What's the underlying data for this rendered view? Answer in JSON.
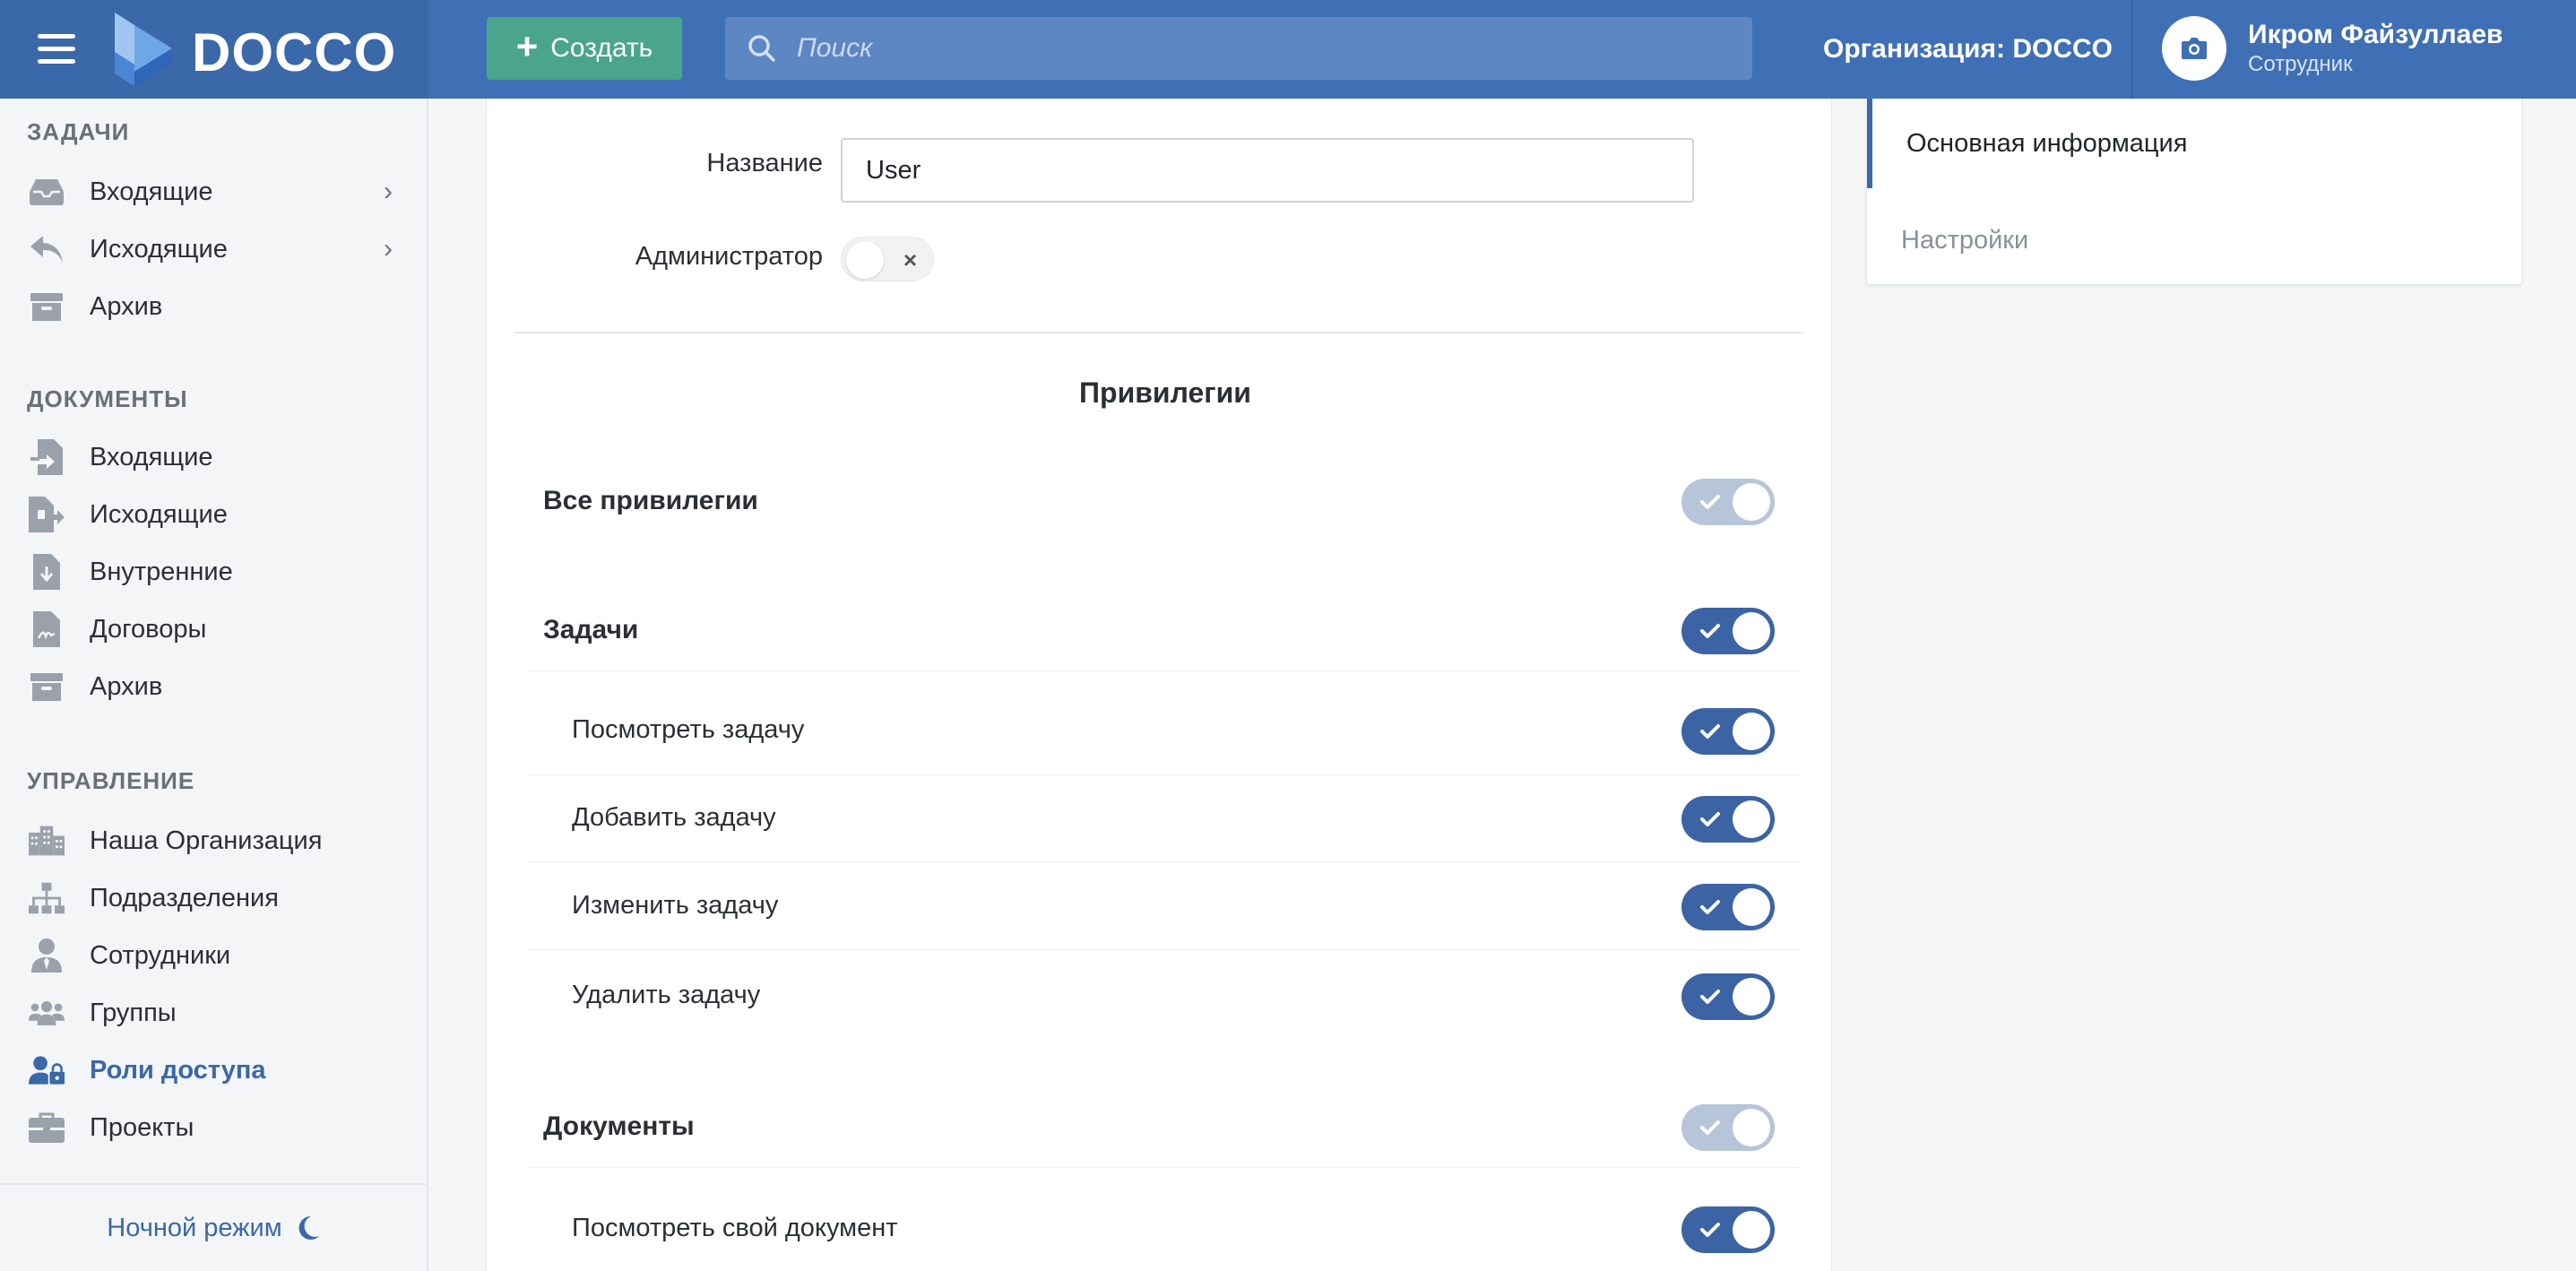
{
  "header": {
    "brand": "DOCCO",
    "create_label": "Создать",
    "search_placeholder": "Поиск",
    "organization": "Организация: DOCCO",
    "user_name": "Икром Файзуллаев",
    "user_role": "Сотрудник"
  },
  "sidebar": {
    "tasks_title": "ЗАДАЧИ",
    "tasks": [
      {
        "label": "Входящие",
        "icon": "inbox-icon"
      },
      {
        "label": "Исходящие",
        "icon": "reply-icon"
      },
      {
        "label": "Архив",
        "icon": "archive-icon"
      }
    ],
    "docs_title": "ДОКУМЕНТЫ",
    "docs": [
      {
        "label": "Входящие",
        "icon": "file-import-icon"
      },
      {
        "label": "Исходящие",
        "icon": "file-export-icon"
      },
      {
        "label": "Внутренние",
        "icon": "file-download-icon"
      },
      {
        "label": "Договоры",
        "icon": "file-signature-icon"
      },
      {
        "label": "Архив",
        "icon": "archive-icon"
      }
    ],
    "mgmt_title": "УПРАВЛЕНИЕ",
    "mgmt": [
      {
        "label": "Наша Организация",
        "icon": "building-icon"
      },
      {
        "label": "Подразделения",
        "icon": "sitemap-icon"
      },
      {
        "label": "Сотрудники",
        "icon": "user-tie-icon"
      },
      {
        "label": "Группы",
        "icon": "users-icon"
      },
      {
        "label": "Роли доступа",
        "icon": "user-lock-icon",
        "active": true
      },
      {
        "label": "Проекты",
        "icon": "briefcase-icon"
      }
    ],
    "night_mode": "Ночной режим"
  },
  "form": {
    "name_label": "Название",
    "name_value": "User",
    "admin_label": "Администратор",
    "admin_enabled": false
  },
  "privileges": {
    "title": "Привилегии",
    "all_label": "Все привилегии",
    "all_state": "partial",
    "groups": [
      {
        "label": "Задачи",
        "state": "on",
        "items": [
          {
            "label": "Посмотреть задачу",
            "state": "on"
          },
          {
            "label": "Добавить задачу",
            "state": "on"
          },
          {
            "label": "Изменить задачу",
            "state": "on"
          },
          {
            "label": "Удалить задачу",
            "state": "on"
          }
        ]
      },
      {
        "label": "Документы",
        "state": "partial",
        "items": [
          {
            "label": "Посмотреть свой документ",
            "state": "on"
          }
        ]
      }
    ]
  },
  "right_panel": {
    "tabs": [
      "Основная информация",
      "Настройки"
    ],
    "active_tab": 0
  },
  "colors": {
    "topbar": "#3f6fb4",
    "create_button": "#4aa58c",
    "toggle_on": "#3c64a4",
    "toggle_partial": "#b7c5d8",
    "accent": "#3a68a8"
  }
}
